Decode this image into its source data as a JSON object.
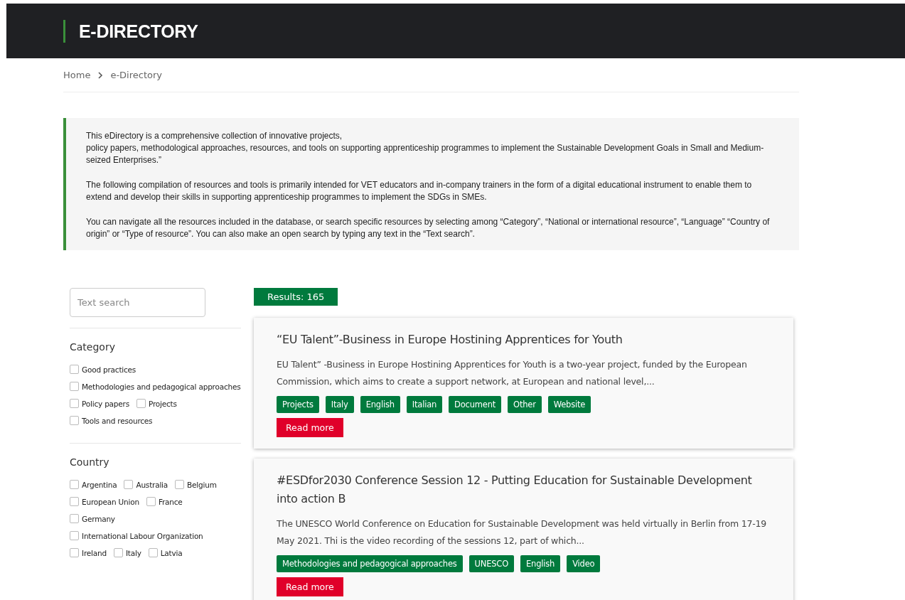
{
  "header": {
    "title": "E-DIRECTORY"
  },
  "breadcrumb": [
    {
      "label": "Home"
    },
    {
      "label": "e-Directory"
    }
  ],
  "intro": [
    "This eDirectory is a comprehensive collection of innovative projects,\npolicy papers, methodological approaches, resources, and tools on supporting apprenticeship programmes to implement the Sustainable Development Goals in Small and Medium-seized Enterprises.”",
    "The following compilation of resources and tools is primarily intended for VET educators and in-company trainers in the form of a digital educational instrument to enable them to extend and develop their skills in supporting apprenticeship programmes to implement the SDGs in SMEs.",
    "You can navigate all the resources included in the database, or search specific resources by selecting among “Category”, “National or international resource”, “Language” “Country of origin” or “Type of resource”. You can also make an open search by typing any text in the “Text search”."
  ],
  "search": {
    "placeholder": "Text search"
  },
  "filters": [
    {
      "title": "Category",
      "rows": [
        [
          {
            "label": "Good practices",
            "checked": false
          }
        ],
        [
          {
            "label": "Methodologies and pedagogical approaches",
            "checked": false
          }
        ],
        [
          {
            "label": "Policy papers",
            "checked": false
          },
          {
            "label": "Projects",
            "checked": false
          }
        ],
        [
          {
            "label": "Tools and resources",
            "checked": false
          }
        ]
      ]
    },
    {
      "title": "Country",
      "rows": [
        [
          {
            "label": "Argentina",
            "checked": false
          },
          {
            "label": "Australia",
            "checked": false
          },
          {
            "label": "Belgium",
            "checked": false
          }
        ],
        [
          {
            "label": "European Union",
            "checked": false
          },
          {
            "label": "France",
            "checked": false
          }
        ],
        [
          {
            "label": "Germany",
            "checked": false
          }
        ],
        [
          {
            "label": "International Labour Organization",
            "checked": false
          }
        ],
        [
          {
            "label": "Ireland",
            "checked": false
          },
          {
            "label": "Italy",
            "checked": false
          },
          {
            "label": "Latvia",
            "checked": false
          }
        ]
      ]
    }
  ],
  "results": {
    "count": "Results: 165",
    "items": [
      {
        "title": "“EU Talent”-Business in Europe Hostining Apprentices for Youth",
        "summary": "EU Talent” -Business in Europe Hostining Apprentices for Youth is a two-year project, funded by the European Commission, which aims to create a support network, at European and national level,...",
        "tags": [
          "Projects",
          "Italy",
          "English",
          "Italian",
          "Document",
          "Other",
          "Website"
        ],
        "button": "Read more"
      },
      {
        "title": "#ESDfor2030 Conference Session 12 - Putting Education for Sustainable Development into action B",
        "summary": "The UNESCO World Conference on Education for Sustainable Development was held virtually in Berlin from 17-19 May 2021. Thi is the video recording of the sessions 12, part of which...",
        "tags": [
          "Methodologies and pedagogical approaches",
          "UNESCO",
          "English",
          "Video"
        ],
        "button": "Read more"
      }
    ]
  }
}
